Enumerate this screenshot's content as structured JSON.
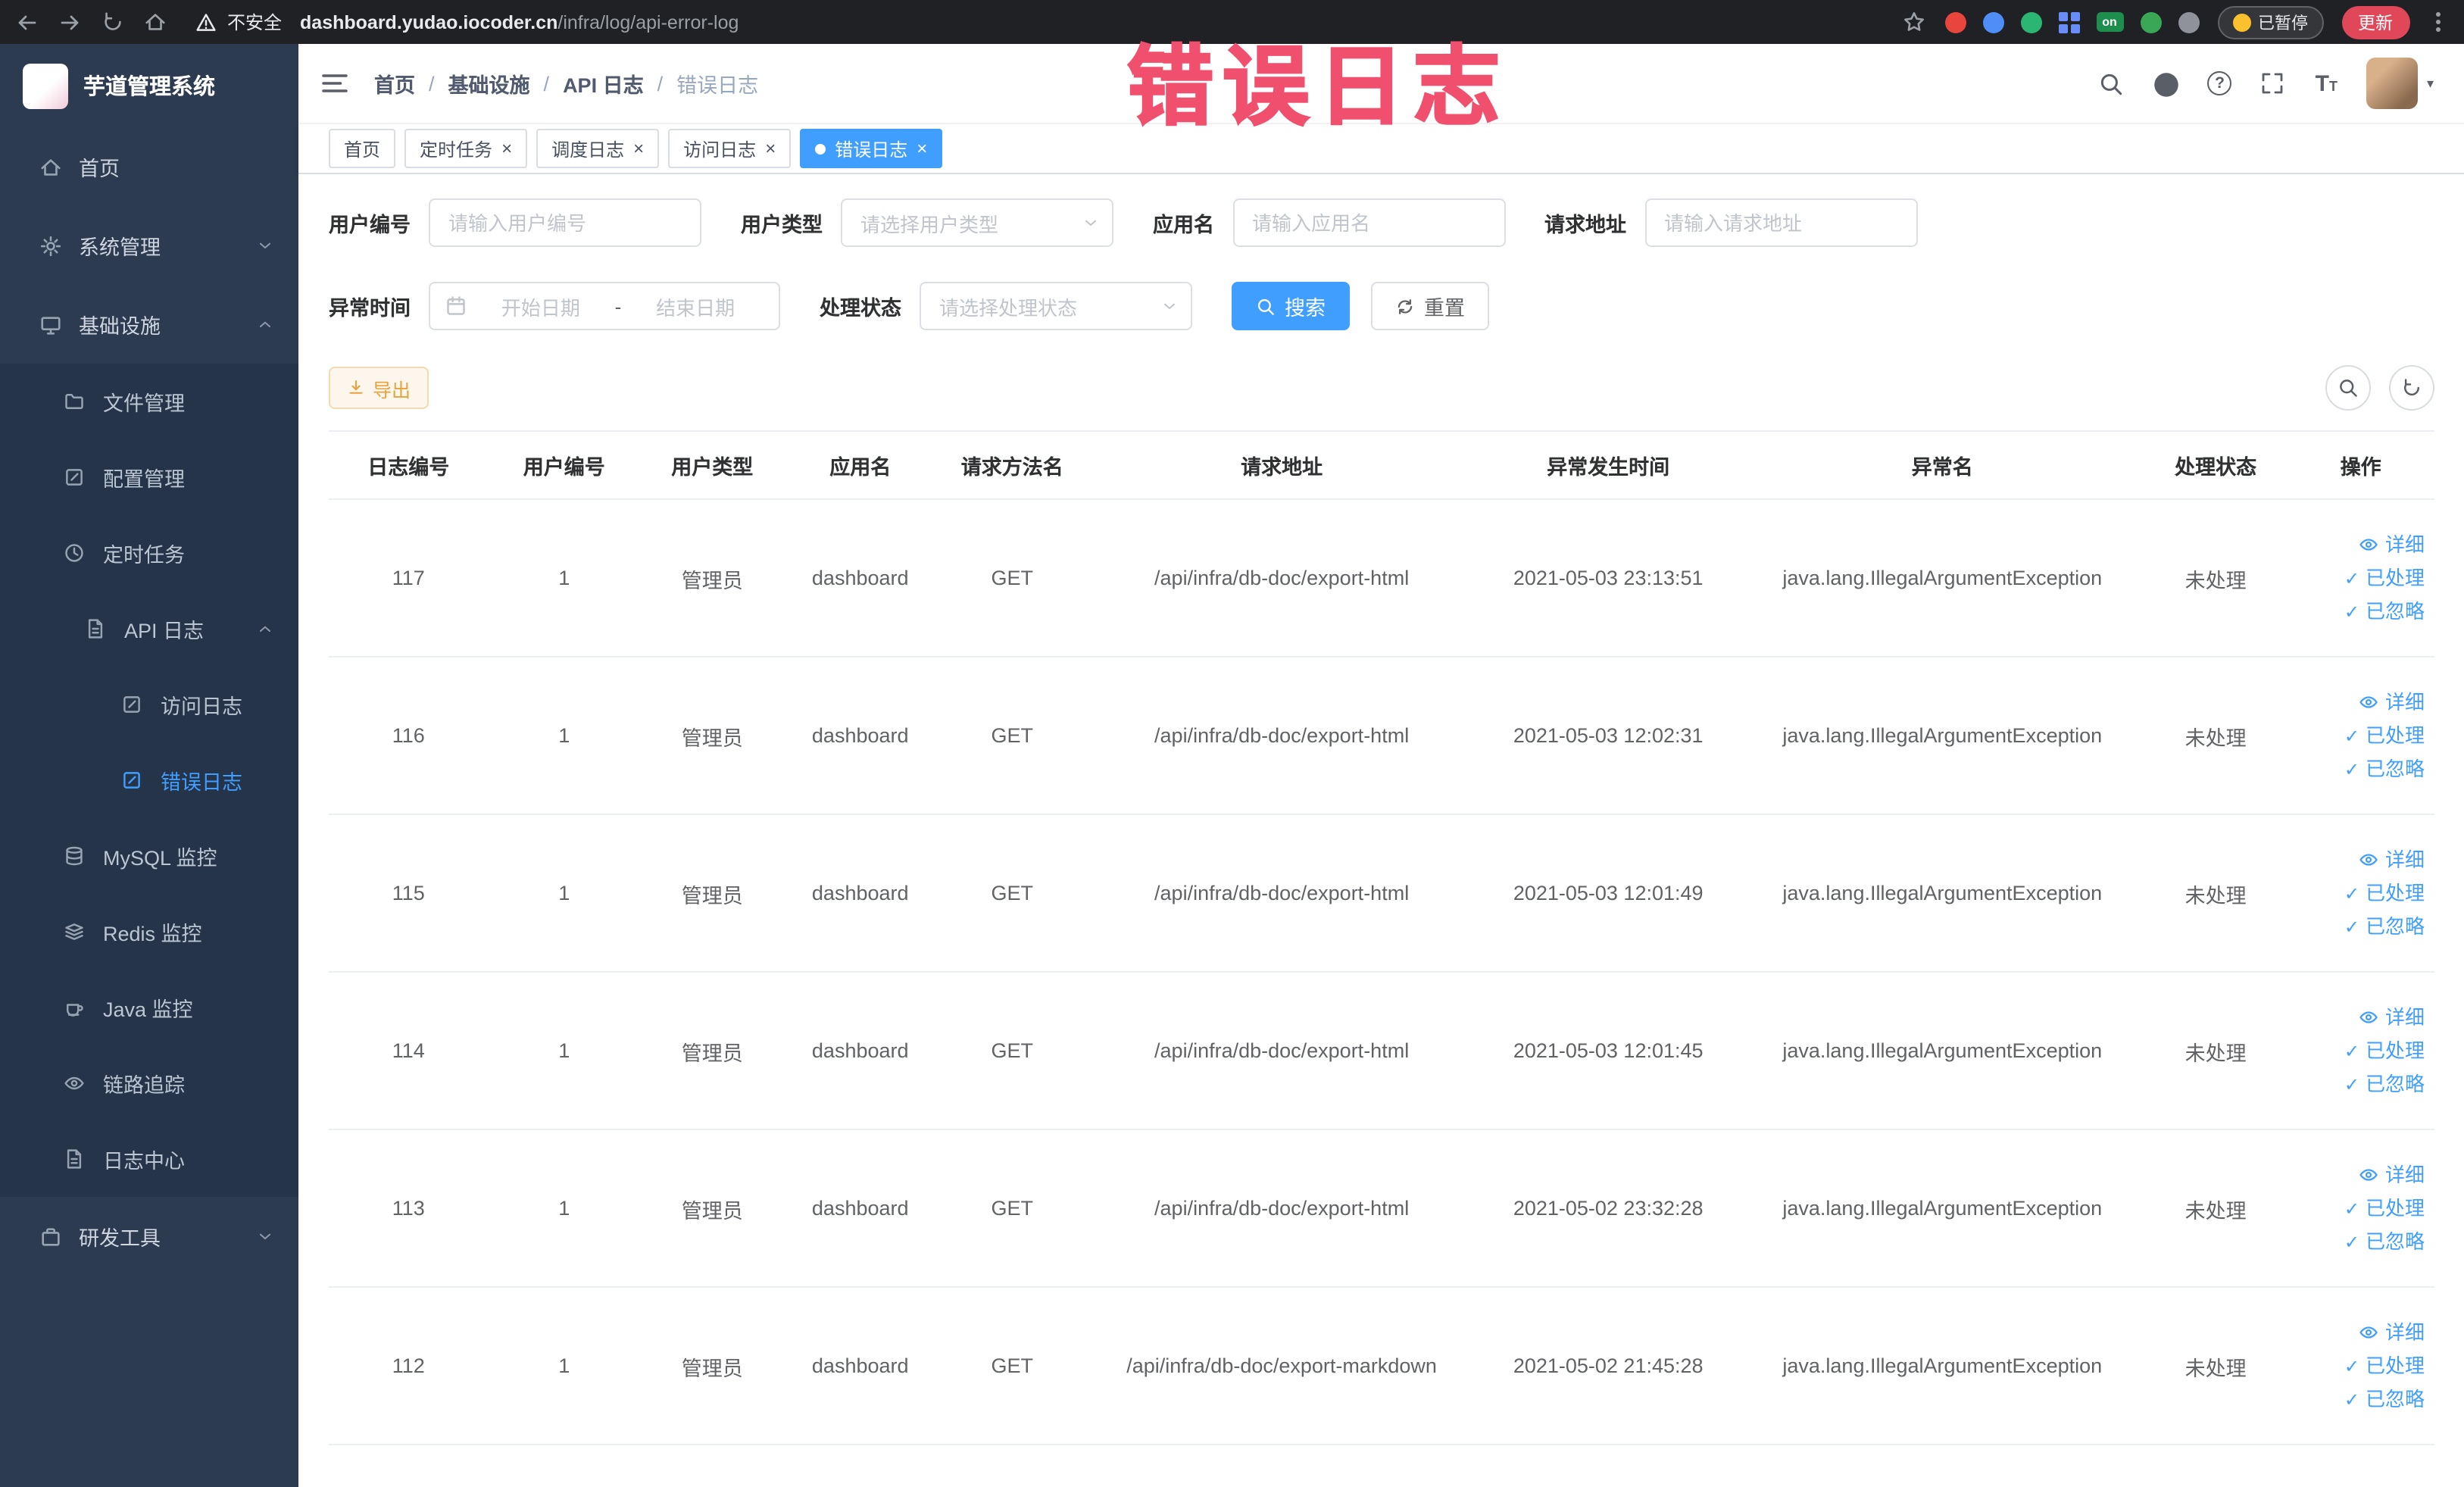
{
  "browser": {
    "security_warning": "不安全",
    "url_domain": "dashboard.yudao.iocoder.cn",
    "url_path": "/infra/log/api-error-log",
    "on_badge": "on",
    "paused_badge": "已暂停",
    "update_button": "更新"
  },
  "annotation": {
    "text": "错误日志"
  },
  "sidebar": {
    "logo_title": "芋道管理系统",
    "home": "首页",
    "system_mgmt": "系统管理",
    "infrastructure": "基础设施",
    "file_mgmt": "文件管理",
    "config_mgmt": "配置管理",
    "scheduled_jobs": "定时任务",
    "api_logs": "API 日志",
    "access_log": "访问日志",
    "error_log": "错误日志",
    "mysql_monitor": "MySQL 监控",
    "redis_monitor": "Redis 监控",
    "java_monitor": "Java 监控",
    "tracing": "链路追踪",
    "log_center": "日志中心",
    "dev_tools": "研发工具"
  },
  "breadcrumb": [
    "首页",
    "基础设施",
    "API 日志",
    "错误日志"
  ],
  "tabs": [
    {
      "label": "首页"
    },
    {
      "label": "定时任务"
    },
    {
      "label": "调度日志"
    },
    {
      "label": "访问日志"
    },
    {
      "label": "错误日志"
    }
  ],
  "filters": {
    "user_id_label": "用户编号",
    "user_id_placeholder": "请输入用户编号",
    "user_type_label": "用户类型",
    "user_type_placeholder": "请选择用户类型",
    "app_name_label": "应用名",
    "app_name_placeholder": "请输入应用名",
    "request_url_label": "请求地址",
    "request_url_placeholder": "请输入请求地址",
    "exception_time_label": "异常时间",
    "date_start_placeholder": "开始日期",
    "date_separator": "-",
    "date_end_placeholder": "结束日期",
    "process_status_label": "处理状态",
    "process_status_placeholder": "请选择处理状态",
    "search_button": "搜索",
    "reset_button": "重置"
  },
  "toolbar": {
    "export_button": "导出"
  },
  "table": {
    "headers": [
      "日志编号",
      "用户编号",
      "用户类型",
      "应用名",
      "请求方法名",
      "请求地址",
      "异常发生时间",
      "异常名",
      "处理状态",
      "操作"
    ],
    "actions": {
      "detail": "详细",
      "processed": "已处理",
      "ignore": "已忽略"
    },
    "rows": [
      {
        "log_id": "117",
        "user_id": "1",
        "user_type": "管理员",
        "app_name": "dashboard",
        "method": "GET",
        "url": "/api/infra/db-doc/export-html",
        "time": "2021-05-03 23:13:51",
        "exception": "java.lang.IllegalArgumentException",
        "status": "未处理"
      },
      {
        "log_id": "116",
        "user_id": "1",
        "user_type": "管理员",
        "app_name": "dashboard",
        "method": "GET",
        "url": "/api/infra/db-doc/export-html",
        "time": "2021-05-03 12:02:31",
        "exception": "java.lang.IllegalArgumentException",
        "status": "未处理"
      },
      {
        "log_id": "115",
        "user_id": "1",
        "user_type": "管理员",
        "app_name": "dashboard",
        "method": "GET",
        "url": "/api/infra/db-doc/export-html",
        "time": "2021-05-03 12:01:49",
        "exception": "java.lang.IllegalArgumentException",
        "status": "未处理"
      },
      {
        "log_id": "114",
        "user_id": "1",
        "user_type": "管理员",
        "app_name": "dashboard",
        "method": "GET",
        "url": "/api/infra/db-doc/export-html",
        "time": "2021-05-03 12:01:45",
        "exception": "java.lang.IllegalArgumentException",
        "status": "未处理"
      },
      {
        "log_id": "113",
        "user_id": "1",
        "user_type": "管理员",
        "app_name": "dashboard",
        "method": "GET",
        "url": "/api/infra/db-doc/export-html",
        "time": "2021-05-02 23:32:28",
        "exception": "java.lang.IllegalArgumentException",
        "status": "未处理"
      },
      {
        "log_id": "112",
        "user_id": "1",
        "user_type": "管理员",
        "app_name": "dashboard",
        "method": "GET",
        "url": "/api/infra/db-doc/export-markdown",
        "time": "2021-05-02 21:45:28",
        "exception": "java.lang.IllegalArgumentException",
        "status": "未处理"
      }
    ]
  },
  "colors": {
    "primary": "#409eff",
    "warning_text": "#e6a23c",
    "annotation": "#f0506e",
    "sidebar_bg": "#2c3b50"
  },
  "icons": {
    "search": "magnifier",
    "github": "filled-circle",
    "help": "question-circle",
    "fullscreen": "corner-brackets",
    "font_size": "T",
    "detail": "eye",
    "processed": "check",
    "ignore": "check",
    "export": "download-arrow",
    "refresh": "circular-arrows"
  }
}
